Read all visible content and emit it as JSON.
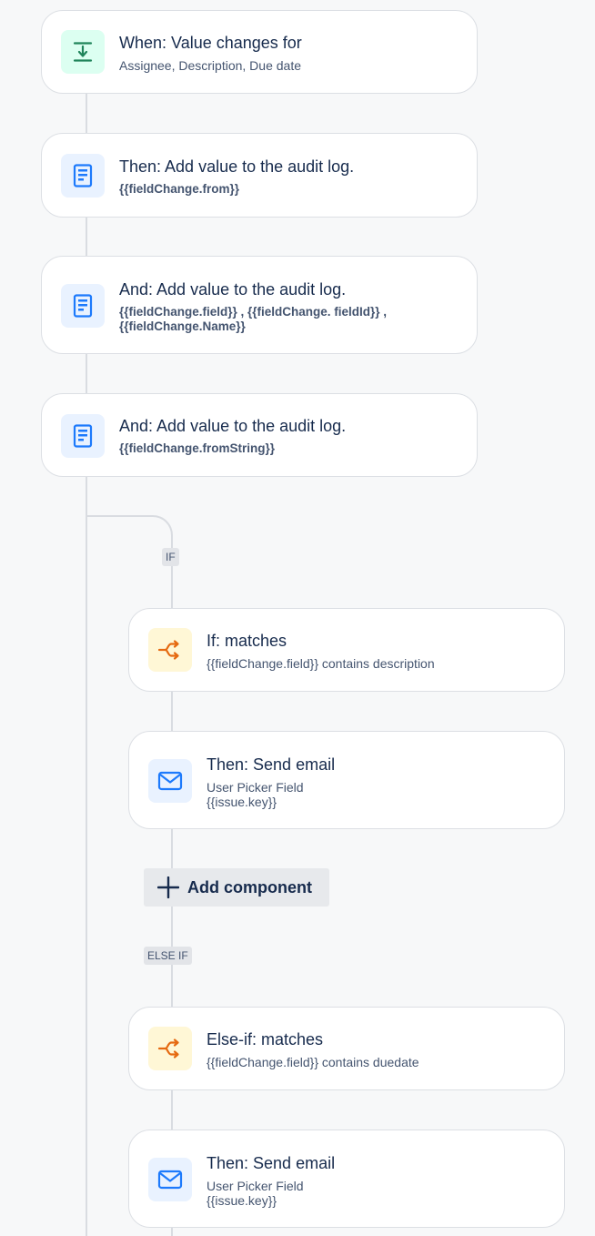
{
  "cards": {
    "trigger": {
      "title": "When: Value changes for",
      "sub": "Assignee, Description, Due date",
      "icon": "download-arrow-icon"
    },
    "audit1": {
      "title": "Then: Add value to the audit log.",
      "sub": "{{fieldChange.from}}",
      "icon": "document-icon"
    },
    "audit2": {
      "title": "And: Add value to the audit log.",
      "sub_line1": "{{fieldChange.field}} , {{fieldChange. fieldId}} ,",
      "sub_line2": "{{fieldChange.Name}}",
      "icon": "document-icon"
    },
    "audit3": {
      "title": "And: Add value to the audit log.",
      "sub": "{{fieldChange.fromString}}",
      "icon": "document-icon"
    },
    "if_cond": {
      "title": "If: matches",
      "sub": "{{fieldChange.field}} contains description",
      "icon": "branch-icon"
    },
    "email1": {
      "title": "Then: Send email",
      "sub_line1": "User Picker Field",
      "sub_line2": "{{issue.key}}",
      "icon": "envelope-icon"
    },
    "elseif_cond": {
      "title": "Else-if: matches",
      "sub": "{{fieldChange.field}} contains duedate",
      "icon": "branch-icon"
    },
    "email2": {
      "title": "Then: Send email",
      "sub_line1": "User Picker Field",
      "sub_line2": "{{issue.key}}",
      "icon": "envelope-icon"
    }
  },
  "branches": {
    "if_label": "IF",
    "elseif_label": "ELSE IF"
  },
  "add_component": {
    "label": "Add component",
    "icon": "plus-icon"
  },
  "colors": {
    "background": "#f7f8f9",
    "card_border": "#dcdfe4",
    "connector": "#d9dce1",
    "trigger_icon": "#1f845a",
    "action_icon": "#1d7afc",
    "condition_icon": "#e56910",
    "text": "#172b4d",
    "subtext": "#44546f"
  }
}
